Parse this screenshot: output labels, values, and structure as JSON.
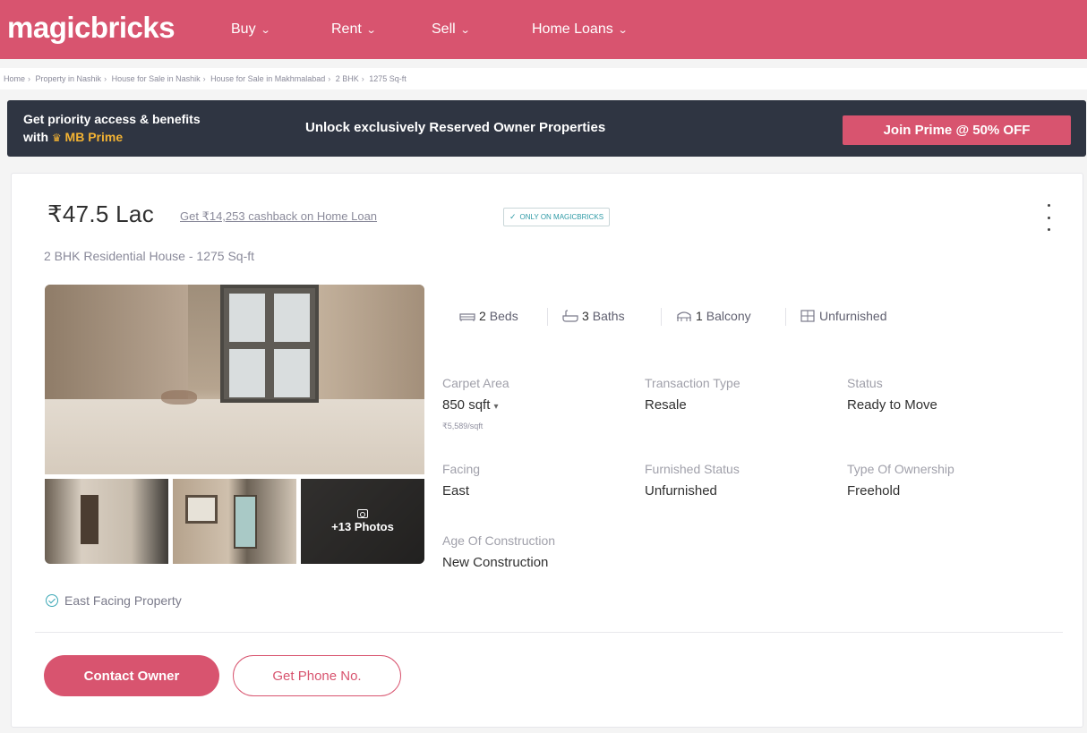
{
  "header": {
    "logo": "magicbricks",
    "nav": [
      {
        "label": "Buy"
      },
      {
        "label": "Rent"
      },
      {
        "label": "Sell"
      },
      {
        "label": "Home Loans"
      }
    ]
  },
  "breadcrumb": [
    "Home",
    "Property in Nashik",
    "House for Sale in Nashik",
    "House for Sale in Makhmalabad",
    "2 BHK",
    "1275 Sq-ft"
  ],
  "prime_banner": {
    "line1": "Get priority access & benefits",
    "line2_prefix": "with",
    "brand": "MB Prime",
    "message": "Unlock exclusively Reserved Owner Properties",
    "button": "Join Prime @ 50% OFF"
  },
  "listing": {
    "price": "₹47.5 Lac",
    "cashback": "Get ₹14,253 cashback on Home Loan",
    "badge": "ONLY ON MAGICBRICKS",
    "title": "2 BHK Residential House - 1275 Sq-ft",
    "photos_more": "+13 Photos",
    "amenities": [
      {
        "num": "2",
        "label": "Beds",
        "icon": "bed-icon"
      },
      {
        "num": "3",
        "label": "Baths",
        "icon": "bath-icon"
      },
      {
        "num": "1",
        "label": "Balcony",
        "icon": "balcony-icon"
      },
      {
        "num": "",
        "label": "Unfurnished",
        "icon": "furniture-icon"
      }
    ],
    "details": {
      "carpet_area": {
        "label": "Carpet Area",
        "value": "850 sqft",
        "sub": "₹5,589/sqft"
      },
      "transaction": {
        "label": "Transaction Type",
        "value": "Resale"
      },
      "status": {
        "label": "Status",
        "value": "Ready to Move"
      },
      "facing": {
        "label": "Facing",
        "value": "East"
      },
      "furnished": {
        "label": "Furnished Status",
        "value": "Unfurnished"
      },
      "ownership": {
        "label": "Type Of Ownership",
        "value": "Freehold"
      },
      "age": {
        "label": "Age Of Construction",
        "value": "New Construction"
      }
    },
    "highlight": "East Facing Property",
    "contact_button": "Contact Owner",
    "phone_button": "Get Phone No."
  },
  "colors": {
    "brand": "#d8546f",
    "banner_bg": "#2f3542",
    "prime_gold": "#f2b233",
    "accent_teal": "#3aa7b5"
  }
}
